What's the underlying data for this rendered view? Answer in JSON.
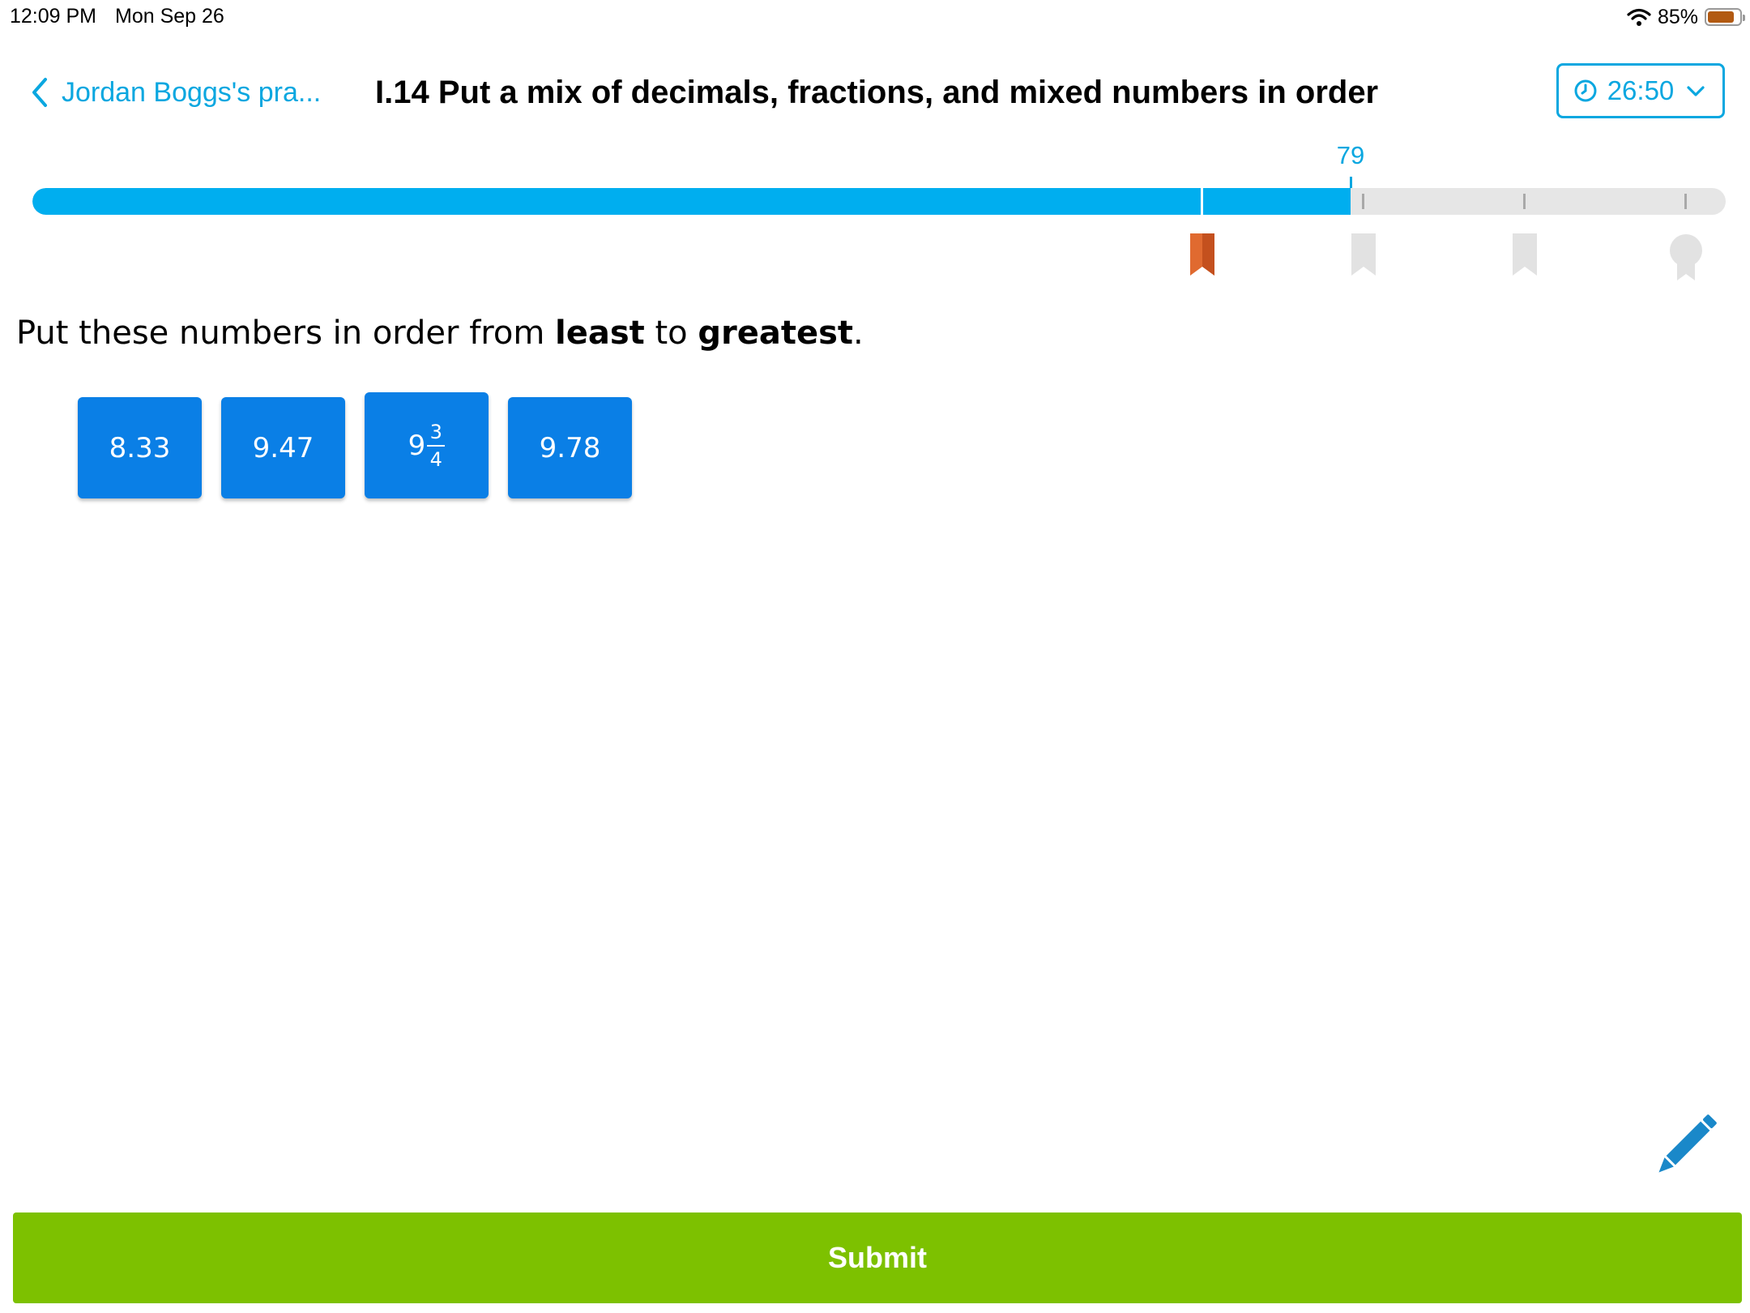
{
  "status_bar": {
    "time": "12:09 PM",
    "date": "Mon Sep 26",
    "battery_text": "85%",
    "battery_level": 0.85,
    "wifi_icon": "wifi-icon"
  },
  "header": {
    "back_label": "Jordan Boggs's pra...",
    "title": "I.14 Put a mix of decimals, fractions, and mixed numbers in order",
    "timer": "26:50"
  },
  "progress": {
    "score": "79",
    "fraction": 0.79,
    "milestones": [
      "bookmark-icon",
      "bookmark-icon",
      "bookmark-icon",
      "award-icon"
    ]
  },
  "question": {
    "prefix": "Put these numbers in order from ",
    "word1": "least",
    "middle": " to ",
    "word2": "greatest",
    "suffix": "."
  },
  "tiles": [
    {
      "value": "8.33"
    },
    {
      "value": "9.47"
    },
    {
      "whole": "9",
      "numerator": "3",
      "denominator": "4"
    },
    {
      "value": "9.78"
    }
  ],
  "submit_label": "Submit",
  "colors": {
    "accent": "#0aa7e0",
    "progress": "#00aeef",
    "tile": "#0a7fe6",
    "submit": "#7dc100",
    "earned_milestone": "#e06a30"
  }
}
